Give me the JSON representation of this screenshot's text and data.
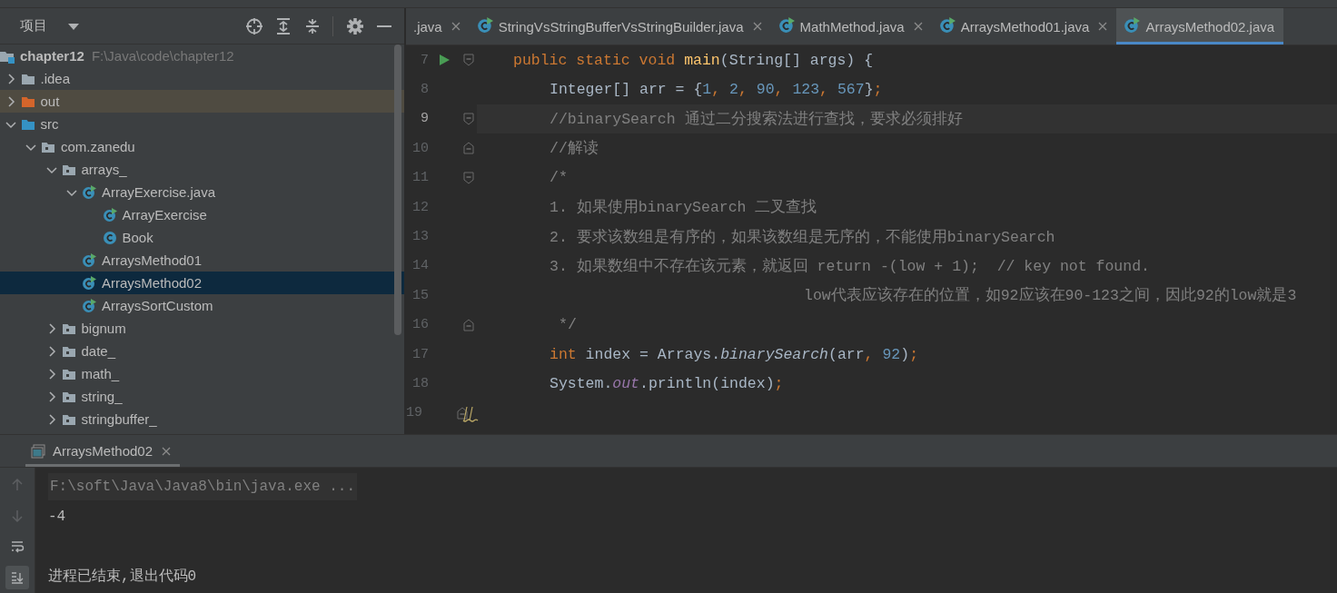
{
  "project_panel": {
    "title": "项目",
    "tree": [
      {
        "name": "chapter12",
        "path": "F:\\Java\\code\\chapter12",
        "kind": "module",
        "selected": false,
        "children": [
          {
            "name": ".idea",
            "kind": "folder",
            "expanded": false,
            "selected": false
          },
          {
            "name": "out",
            "kind": "excluded",
            "expanded": false,
            "selected": false
          },
          {
            "name": "src",
            "kind": "source",
            "expanded": true,
            "selected": false,
            "children": [
              {
                "name": "com.zanedu",
                "kind": "package",
                "expanded": true,
                "selected": false,
                "children": [
                  {
                    "name": "arrays_",
                    "kind": "package",
                    "expanded": true,
                    "selected": false,
                    "children": [
                      {
                        "name": "ArrayExercise.java",
                        "kind": "runnable_class",
                        "expanded": true,
                        "selected": false,
                        "children": [
                          {
                            "name": "ArrayExercise",
                            "kind": "runnable_class",
                            "selected": false
                          },
                          {
                            "name": "Book",
                            "kind": "class",
                            "selected": false
                          }
                        ]
                      },
                      {
                        "name": "ArraysMethod01",
                        "kind": "runnable_class",
                        "selected": false
                      },
                      {
                        "name": "ArraysMethod02",
                        "kind": "runnable_class",
                        "selected": true
                      },
                      {
                        "name": "ArraysSortCustom",
                        "kind": "runnable_class",
                        "selected": false
                      }
                    ]
                  },
                  {
                    "name": "bignum",
                    "kind": "package",
                    "expanded": false,
                    "selected": false
                  },
                  {
                    "name": "date_",
                    "kind": "package",
                    "expanded": false,
                    "selected": false
                  },
                  {
                    "name": "math_",
                    "kind": "package",
                    "expanded": false,
                    "selected": false
                  },
                  {
                    "name": "string_",
                    "kind": "package",
                    "expanded": false,
                    "selected": false
                  },
                  {
                    "name": "stringbuffer_",
                    "kind": "package",
                    "expanded": false,
                    "selected": false
                  }
                ]
              }
            ]
          }
        ]
      }
    ]
  },
  "editor": {
    "tabs": [
      {
        "label": ".java",
        "kind": "unknown",
        "selected": false,
        "closable": true
      },
      {
        "label": "StringVsStringBufferVsStringBuilder.java",
        "kind": "runnable_class",
        "selected": false,
        "closable": true
      },
      {
        "label": "MathMethod.java",
        "kind": "runnable_class",
        "selected": false,
        "closable": true
      },
      {
        "label": "ArraysMethod01.java",
        "kind": "runnable_class",
        "selected": false,
        "closable": true
      },
      {
        "label": "ArraysMethod02.java",
        "kind": "runnable_class",
        "selected": true,
        "closable": false
      }
    ],
    "lines": [
      {
        "number": "7",
        "kind": "signature",
        "current": false,
        "run": true,
        "fold_start": true,
        "fold_end": false,
        "warning": false,
        "tokens": [
          {
            "kind": "kw",
            "text": "public static void "
          },
          {
            "kind": "decl",
            "text": "main"
          },
          {
            "kind": "plain",
            "text": "(String[] args) {"
          }
        ]
      },
      {
        "number": "8",
        "kind": "statement",
        "current": false,
        "run": false,
        "fold_start": false,
        "fold_end": false,
        "warning": false,
        "tokens": [
          {
            "kind": "plain",
            "text": "Integer[] arr = {"
          },
          {
            "kind": "num",
            "text": "1"
          },
          {
            "kind": "punct",
            "text": ", "
          },
          {
            "kind": "num",
            "text": "2"
          },
          {
            "kind": "punct",
            "text": ", "
          },
          {
            "kind": "num",
            "text": "90"
          },
          {
            "kind": "punct",
            "text": ", "
          },
          {
            "kind": "num",
            "text": "123"
          },
          {
            "kind": "punct",
            "text": ", "
          },
          {
            "kind": "num",
            "text": "567"
          },
          {
            "kind": "plain",
            "text": "}"
          },
          {
            "kind": "punct",
            "text": ";"
          }
        ]
      },
      {
        "number": "9",
        "kind": "statement",
        "current": true,
        "run": false,
        "fold_start": true,
        "fold_end": false,
        "warning": false,
        "tokens": [
          {
            "kind": "comment",
            "text": "//binarySearch 通过二分搜索法进行查找，要求必须排好"
          }
        ]
      },
      {
        "number": "10",
        "kind": "statement",
        "current": false,
        "run": false,
        "fold_start": false,
        "fold_end": true,
        "warning": false,
        "tokens": [
          {
            "kind": "comment",
            "text": "//解读"
          }
        ]
      },
      {
        "number": "11",
        "kind": "statement",
        "current": false,
        "run": false,
        "fold_start": true,
        "fold_end": false,
        "warning": false,
        "tokens": [
          {
            "kind": "comment",
            "text": "/*"
          }
        ]
      },
      {
        "number": "12",
        "kind": "statement",
        "current": false,
        "run": false,
        "fold_start": false,
        "fold_end": false,
        "warning": false,
        "tokens": [
          {
            "kind": "comment",
            "text": "1. 如果使用binarySearch 二叉查找"
          }
        ]
      },
      {
        "number": "13",
        "kind": "statement",
        "current": false,
        "run": false,
        "fold_start": false,
        "fold_end": false,
        "warning": false,
        "tokens": [
          {
            "kind": "comment",
            "text": "2. 要求该数组是有序的，如果该数组是无序的，不能使用binarySearch"
          }
        ]
      },
      {
        "number": "14",
        "kind": "statement",
        "current": false,
        "run": false,
        "fold_start": false,
        "fold_end": false,
        "warning": false,
        "tokens": [
          {
            "kind": "comment",
            "text": "3. 如果数组中不存在该元素，就返回 return -(low + 1);  // key not found."
          }
        ]
      },
      {
        "number": "15",
        "kind": "continuation",
        "current": false,
        "run": false,
        "fold_start": false,
        "fold_end": false,
        "warning": false,
        "tokens": [
          {
            "kind": "comment",
            "text": "low代表应该存在的位置，如92应该在90-123之间，因此92的low就是3"
          }
        ]
      },
      {
        "number": "16",
        "kind": "comment_close",
        "current": false,
        "run": false,
        "fold_start": false,
        "fold_end": true,
        "warning": false,
        "tokens": [
          {
            "kind": "comment",
            "text": "*/"
          }
        ]
      },
      {
        "number": "17",
        "kind": "statement",
        "current": false,
        "run": false,
        "fold_start": false,
        "fold_end": false,
        "warning": false,
        "tokens": [
          {
            "kind": "kw",
            "text": "int"
          },
          {
            "kind": "plain",
            "text": " index = Arrays."
          },
          {
            "kind": "italic_call",
            "text": "binarySearch"
          },
          {
            "kind": "plain",
            "text": "(arr"
          },
          {
            "kind": "punct",
            "text": ", "
          },
          {
            "kind": "num",
            "text": "92"
          },
          {
            "kind": "plain",
            "text": ")"
          },
          {
            "kind": "punct",
            "text": ";"
          }
        ]
      },
      {
        "number": "18",
        "kind": "statement",
        "current": false,
        "run": false,
        "fold_start": false,
        "fold_end": false,
        "warning": false,
        "tokens": [
          {
            "kind": "plain",
            "text": "System."
          },
          {
            "kind": "static",
            "text": "out"
          },
          {
            "kind": "plain",
            "text": ".println(index)"
          },
          {
            "kind": "punct",
            "text": ";"
          }
        ]
      },
      {
        "number": "19",
        "kind": "statement",
        "current": false,
        "run": false,
        "fold_start": false,
        "fold_end": true,
        "warning": true
      }
    ]
  },
  "run_panel": {
    "tabs": [
      {
        "label": "ArraysMethod02",
        "selected": true
      }
    ],
    "tools": [
      {
        "kind": "up",
        "disabled": true,
        "on": false
      },
      {
        "kind": "down",
        "disabled": true,
        "on": false
      },
      {
        "kind": "wrap",
        "disabled": false,
        "on": false
      },
      {
        "kind": "scroll_end",
        "disabled": false,
        "on": true
      }
    ],
    "console": [
      {
        "kind": "command",
        "text": "F:\\soft\\Java\\Java8\\bin\\java.exe ..."
      },
      {
        "kind": "output",
        "text": "-4"
      },
      {
        "kind": "blank"
      },
      {
        "kind": "exit",
        "text": "进程已结束,退出代码0"
      }
    ]
  }
}
